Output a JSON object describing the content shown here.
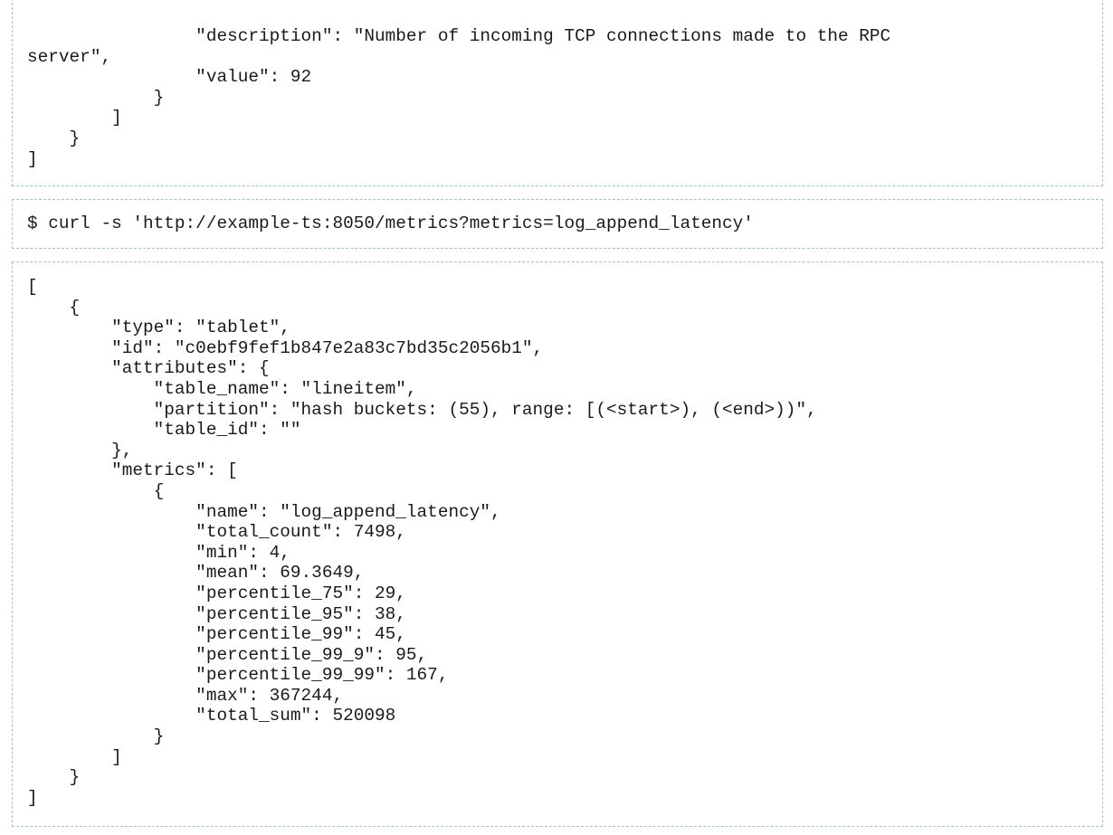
{
  "blocks": [
    {
      "name": "previous-output-tail",
      "lines": [
        "                \"description\": \"Number of incoming TCP connections made to the RPC",
        "server\",",
        "                \"value\": 92",
        "            }",
        "        ]",
        "    }",
        "]"
      ]
    },
    {
      "name": "curl-command",
      "lines": [
        "$ curl -s 'http://example-ts:8050/metrics?metrics=log_append_latency'"
      ]
    },
    {
      "name": "json-response",
      "lines": [
        "[",
        "    {",
        "        \"type\": \"tablet\",",
        "        \"id\": \"c0ebf9fef1b847e2a83c7bd35c2056b1\",",
        "        \"attributes\": {",
        "            \"table_name\": \"lineitem\",",
        "            \"partition\": \"hash buckets: (55), range: [(<start>), (<end>))\",",
        "            \"table_id\": \"\"",
        "        },",
        "        \"metrics\": [",
        "            {",
        "                \"name\": \"log_append_latency\",",
        "                \"total_count\": 7498,",
        "                \"min\": 4,",
        "                \"mean\": 69.3649,",
        "                \"percentile_75\": 29,",
        "                \"percentile_95\": 38,",
        "                \"percentile_99\": 45,",
        "                \"percentile_99_9\": 95,",
        "                \"percentile_99_99\": 167,",
        "                \"max\": 367244,",
        "                \"total_sum\": 520098",
        "            }",
        "        ]",
        "    }",
        "]"
      ]
    }
  ]
}
